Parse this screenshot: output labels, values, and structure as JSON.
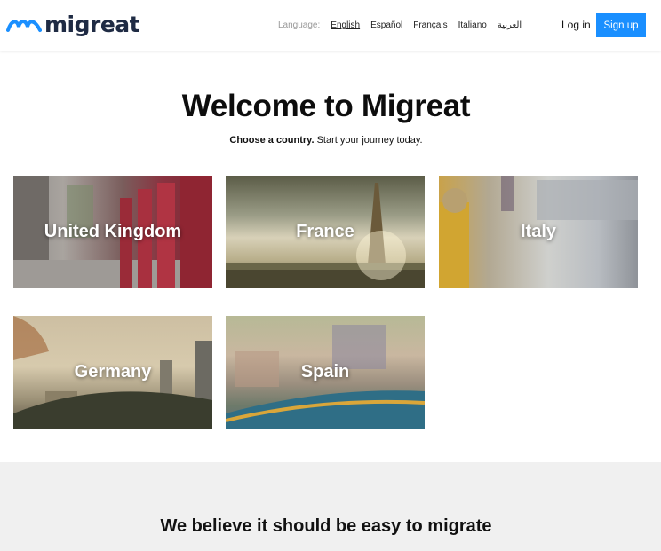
{
  "header": {
    "logo_text": "migreat",
    "language_label": "Language:",
    "languages": [
      "English",
      "Español",
      "Français",
      "Italiano",
      "العربية"
    ],
    "active_language": "English",
    "login_label": "Log in",
    "signup_label": "Sign up"
  },
  "hero": {
    "title": "Welcome to Migreat",
    "subtitle_bold": "Choose a country.",
    "subtitle_rest": " Start your journey today."
  },
  "countries": [
    {
      "name": "United Kingdom"
    },
    {
      "name": "France"
    },
    {
      "name": "Italy"
    },
    {
      "name": "Germany"
    },
    {
      "name": "Spain"
    }
  ],
  "band": {
    "title": "We believe it should be easy to migrate"
  },
  "colors": {
    "accent": "#1a8fff",
    "logo": "#1f2b44",
    "logo_wave": "#1a8fff",
    "band_bg": "#f0f0f0"
  }
}
